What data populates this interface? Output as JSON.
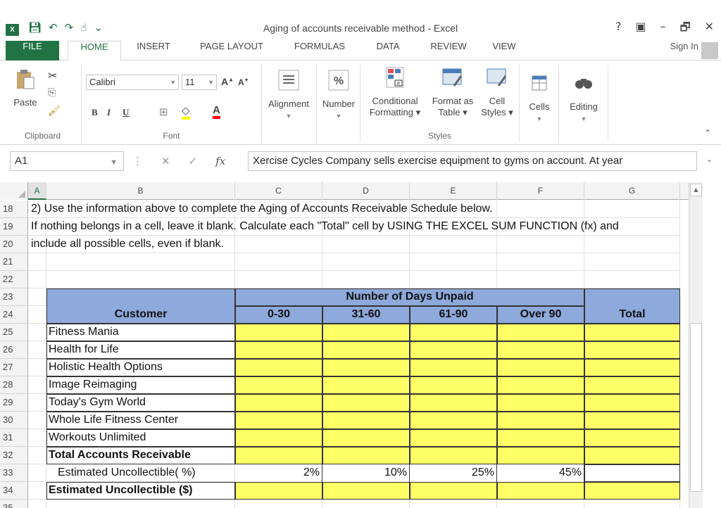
{
  "window": {
    "title": "Aging of accounts receivable method - Excel",
    "app_icon": "excel-icon",
    "controls": [
      "?",
      "▣",
      "–",
      "🗗",
      "✕"
    ]
  },
  "qat": [
    "save-icon",
    "undo-icon",
    "redo-icon",
    "touch-mode-icon",
    "customize-icon"
  ],
  "tabs": [
    {
      "label": "FILE"
    },
    {
      "label": "HOME"
    },
    {
      "label": "INSERT"
    },
    {
      "label": "PAGE LAYOUT"
    },
    {
      "label": "FORMULAS"
    },
    {
      "label": "DATA"
    },
    {
      "label": "REVIEW"
    },
    {
      "label": "VIEW"
    }
  ],
  "sign_in": "Sign In",
  "ribbon": {
    "clipboard": {
      "paste": "Paste",
      "label": "Clipboard"
    },
    "font": {
      "name": "Calibri",
      "size": "11",
      "label": "Font",
      "bold": "B",
      "italic": "I",
      "underline": "U"
    },
    "alignment": "Alignment",
    "number": "Number",
    "cond_format_line1": "Conditional",
    "cond_format_line2": "Formatting ▾",
    "format_table_line1": "Format as",
    "format_table_line2": "Table ▾",
    "cell_styles_line1": "Cell",
    "cell_styles_line2": "Styles ▾",
    "styles_label": "Styles",
    "cells": "Cells",
    "editing": "Editing"
  },
  "formula_bar": {
    "name_box": "A1",
    "fx": "fx",
    "content": "Xercise Cycles Company sells exercise equipment to gyms on account.  At year"
  },
  "columns": [
    "A",
    "B",
    "C",
    "D",
    "E",
    "F",
    "G"
  ],
  "rows": {
    "r18": "2) Use the information above to complete the Aging of Accounts Receivable Schedule below.",
    "r19": "If nothing belongs in a cell, leave it blank.  Calculate each \"Total\" cell by USING THE EXCEL SUM FUNCTION (fx) and",
    "r20": "include all possible cells, even if blank."
  },
  "row_numbers": [
    "18",
    "19",
    "20",
    "21",
    "22",
    "23",
    "24",
    "25",
    "26",
    "27",
    "28",
    "29",
    "30",
    "31",
    "32",
    "33",
    "34",
    "35"
  ],
  "table": {
    "group_header": "Number of Days Unpaid",
    "customer_header": "Customer",
    "bucket_headers": [
      "0-30",
      "31-60",
      "61-90",
      "Over 90"
    ],
    "total_header": "Total",
    "customers": [
      "Fitness Mania",
      "Health for Life",
      "Holistic Health Options",
      "Image Reimaging",
      "Today's Gym World",
      "Whole Life Fitness Center",
      "Workouts Unlimited"
    ],
    "total_ar_label": "Total Accounts Receivable",
    "est_pct_label": "Estimated Uncollectible( %)",
    "est_pct_values": [
      "2%",
      "10%",
      "25%",
      "45%"
    ],
    "est_dollar_label": "Estimated Uncollectible ($)"
  },
  "colors": {
    "excel_green": "#217346",
    "header_blue": "#8ea9db",
    "input_yellow": "#ffff66"
  }
}
